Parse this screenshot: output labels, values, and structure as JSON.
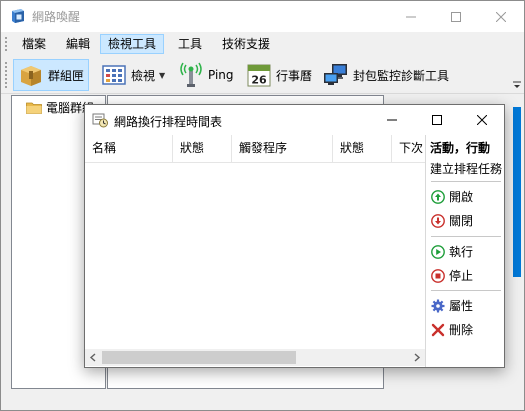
{
  "window": {
    "title": "網路喚醒"
  },
  "menu": {
    "items": [
      {
        "label": "檔案"
      },
      {
        "label": "編輯"
      },
      {
        "label": "檢視工具"
      },
      {
        "label": "工具"
      },
      {
        "label": "技術支援"
      }
    ],
    "active_index": 2
  },
  "toolbar": {
    "group_button": "群組匣",
    "view_button": "檢視",
    "ping_button": "Ping",
    "calendar_button": "行事曆",
    "calendar_day": "26",
    "packet_button": "封包監控診斷工具"
  },
  "tree": {
    "root_label": "電腦群組"
  },
  "dialog": {
    "title": "網路換行排程時間表",
    "columns": [
      "名稱",
      "狀態",
      "觸發程序",
      "狀態",
      "下次"
    ],
    "actions": {
      "title": "活動，行動",
      "subtitle": "建立排程任務",
      "items": [
        {
          "label": "開啟",
          "icon": "up-arrow-icon"
        },
        {
          "label": "關閉",
          "icon": "down-arrow-icon"
        },
        {
          "label": "執行",
          "icon": "play-icon"
        },
        {
          "label": "停止",
          "icon": "stop-icon"
        },
        {
          "label": "屬性",
          "icon": "gear-icon"
        },
        {
          "label": "刪除",
          "icon": "delete-x-icon"
        }
      ]
    }
  },
  "colors": {
    "accent": "#0078d7",
    "menu_highlight": "#cce8ff",
    "folder": "#e8b84a",
    "green": "#1e9e3a",
    "red": "#c9302c",
    "gear": "#4a68c8"
  }
}
